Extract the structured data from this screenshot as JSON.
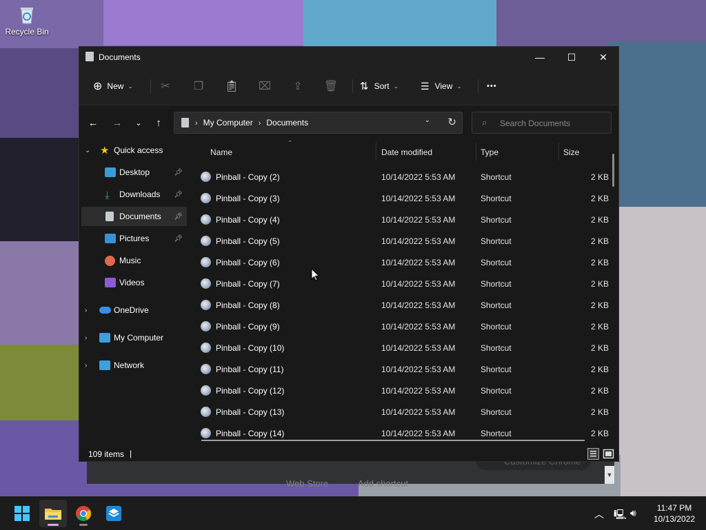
{
  "desktop": {
    "recycle_bin_label": "Recycle Bin"
  },
  "behind_window": {
    "web_store": "Web Store",
    "add_shortcut": "Add shortcut",
    "customize_chrome": "Customize Chrome"
  },
  "window": {
    "title": "Documents",
    "controls": {
      "minimize": "—",
      "maximize": "☐",
      "close": "✕"
    }
  },
  "commandbar": {
    "new_label": "New",
    "sort_label": "Sort",
    "view_label": "View",
    "more_label": "•••"
  },
  "address": {
    "crumbs": [
      "My Computer",
      "Documents"
    ],
    "search_placeholder": "Search Documents"
  },
  "sidebar": {
    "items": [
      {
        "label": "Quick access",
        "icon": "star-icon",
        "color": "#f5c518"
      },
      {
        "label": "Desktop",
        "icon": "desktop-icon",
        "color": "#3a9bd9",
        "pinned": true
      },
      {
        "label": "Downloads",
        "icon": "download-icon",
        "color": "#3aaa6a",
        "pinned": true
      },
      {
        "label": "Documents",
        "icon": "documents-icon",
        "color": "#c8ccd2",
        "pinned": true,
        "selected": true
      },
      {
        "label": "Pictures",
        "icon": "pictures-icon",
        "color": "#3a8fd9",
        "pinned": true
      },
      {
        "label": "Music",
        "icon": "music-icon",
        "color": "#e06a4c"
      },
      {
        "label": "Videos",
        "icon": "videos-icon",
        "color": "#8e5bd8"
      },
      {
        "label": "OneDrive",
        "icon": "cloud-icon",
        "color": "#3b8ee8"
      },
      {
        "label": "My Computer",
        "icon": "computer-icon",
        "color": "#3aa0e0"
      },
      {
        "label": "Network",
        "icon": "network-icon",
        "color": "#3aa0e0"
      }
    ]
  },
  "columns": {
    "name": "Name",
    "date": "Date modified",
    "type": "Type",
    "size": "Size"
  },
  "files": [
    {
      "name": "Pinball - Copy (2)",
      "date": "10/14/2022 5:53 AM",
      "type": "Shortcut",
      "size": "2 KB"
    },
    {
      "name": "Pinball - Copy (3)",
      "date": "10/14/2022 5:53 AM",
      "type": "Shortcut",
      "size": "2 KB"
    },
    {
      "name": "Pinball - Copy (4)",
      "date": "10/14/2022 5:53 AM",
      "type": "Shortcut",
      "size": "2 KB"
    },
    {
      "name": "Pinball - Copy (5)",
      "date": "10/14/2022 5:53 AM",
      "type": "Shortcut",
      "size": "2 KB"
    },
    {
      "name": "Pinball - Copy (6)",
      "date": "10/14/2022 5:53 AM",
      "type": "Shortcut",
      "size": "2 KB"
    },
    {
      "name": "Pinball - Copy (7)",
      "date": "10/14/2022 5:53 AM",
      "type": "Shortcut",
      "size": "2 KB"
    },
    {
      "name": "Pinball - Copy (8)",
      "date": "10/14/2022 5:53 AM",
      "type": "Shortcut",
      "size": "2 KB"
    },
    {
      "name": "Pinball - Copy (9)",
      "date": "10/14/2022 5:53 AM",
      "type": "Shortcut",
      "size": "2 KB"
    },
    {
      "name": "Pinball - Copy (10)",
      "date": "10/14/2022 5:53 AM",
      "type": "Shortcut",
      "size": "2 KB"
    },
    {
      "name": "Pinball - Copy (11)",
      "date": "10/14/2022 5:53 AM",
      "type": "Shortcut",
      "size": "2 KB"
    },
    {
      "name": "Pinball - Copy (12)",
      "date": "10/14/2022 5:53 AM",
      "type": "Shortcut",
      "size": "2 KB"
    },
    {
      "name": "Pinball - Copy (13)",
      "date": "10/14/2022 5:53 AM",
      "type": "Shortcut",
      "size": "2 KB"
    },
    {
      "name": "Pinball - Copy (14)",
      "date": "10/14/2022 5:53 AM",
      "type": "Shortcut",
      "size": "2 KB"
    }
  ],
  "status": {
    "item_count": "109 items"
  },
  "taskbar": {
    "apps": [
      "start-icon",
      "file-explorer-icon",
      "chrome-icon",
      "store-app-icon"
    ],
    "time": "11:47 PM",
    "date": "10/13/2022"
  },
  "colors": {
    "window_bg": "#191919",
    "titlebar_bg": "#202020",
    "selection_bg": "#2d2d2d",
    "accent": "#60cdff"
  }
}
